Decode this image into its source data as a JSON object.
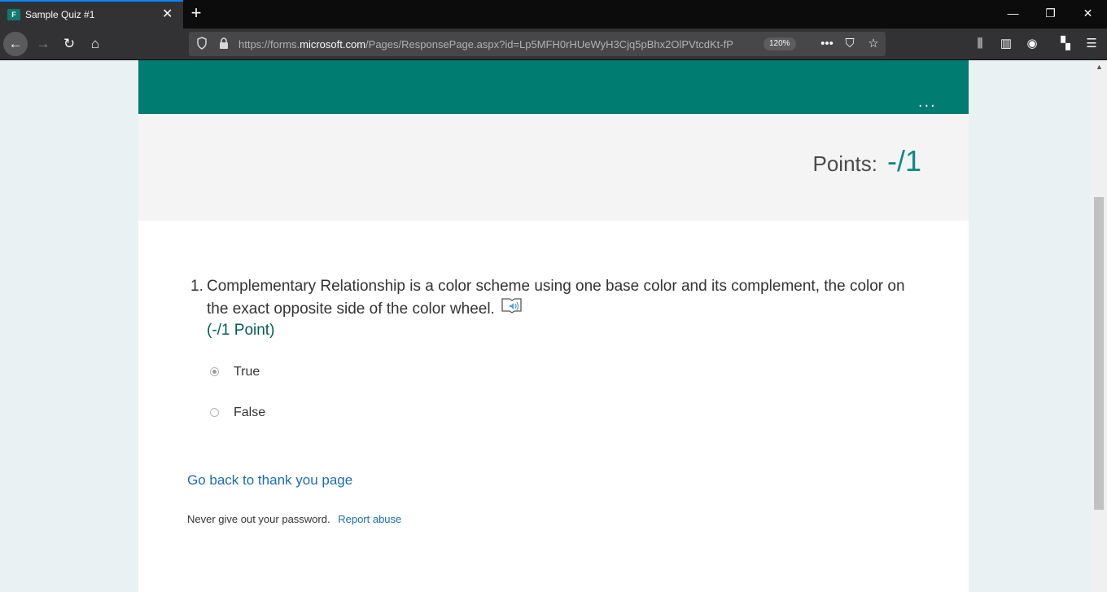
{
  "browser": {
    "tab_title": "Sample Quiz #1",
    "favicon_letter": "F",
    "url_prefix": "https://forms.",
    "url_domain": "microsoft.com",
    "url_path": "/Pages/ResponsePage.aspx?id=Lp5MFH0rHUeWyH3Cjq5pBhx2OlPVtcdKt-fP",
    "zoom": "120%"
  },
  "header": {
    "more_label": "..."
  },
  "points": {
    "label": "Points:",
    "value": "-/1"
  },
  "question": {
    "number": "1.",
    "text": "Complementary Relationship is a color scheme using one base color and its complement, the color on the exact opposite side of the color wheel.",
    "points": "(-/1 Point)",
    "options": [
      {
        "label": "True",
        "selected": true
      },
      {
        "label": "False",
        "selected": false
      }
    ]
  },
  "links": {
    "back": "Go back to thank you page"
  },
  "footer": {
    "note": "Never give out your password.",
    "report": "Report abuse"
  },
  "colors": {
    "header": "#007c70",
    "accent": "#0e8a80",
    "link": "#1d6db3"
  }
}
